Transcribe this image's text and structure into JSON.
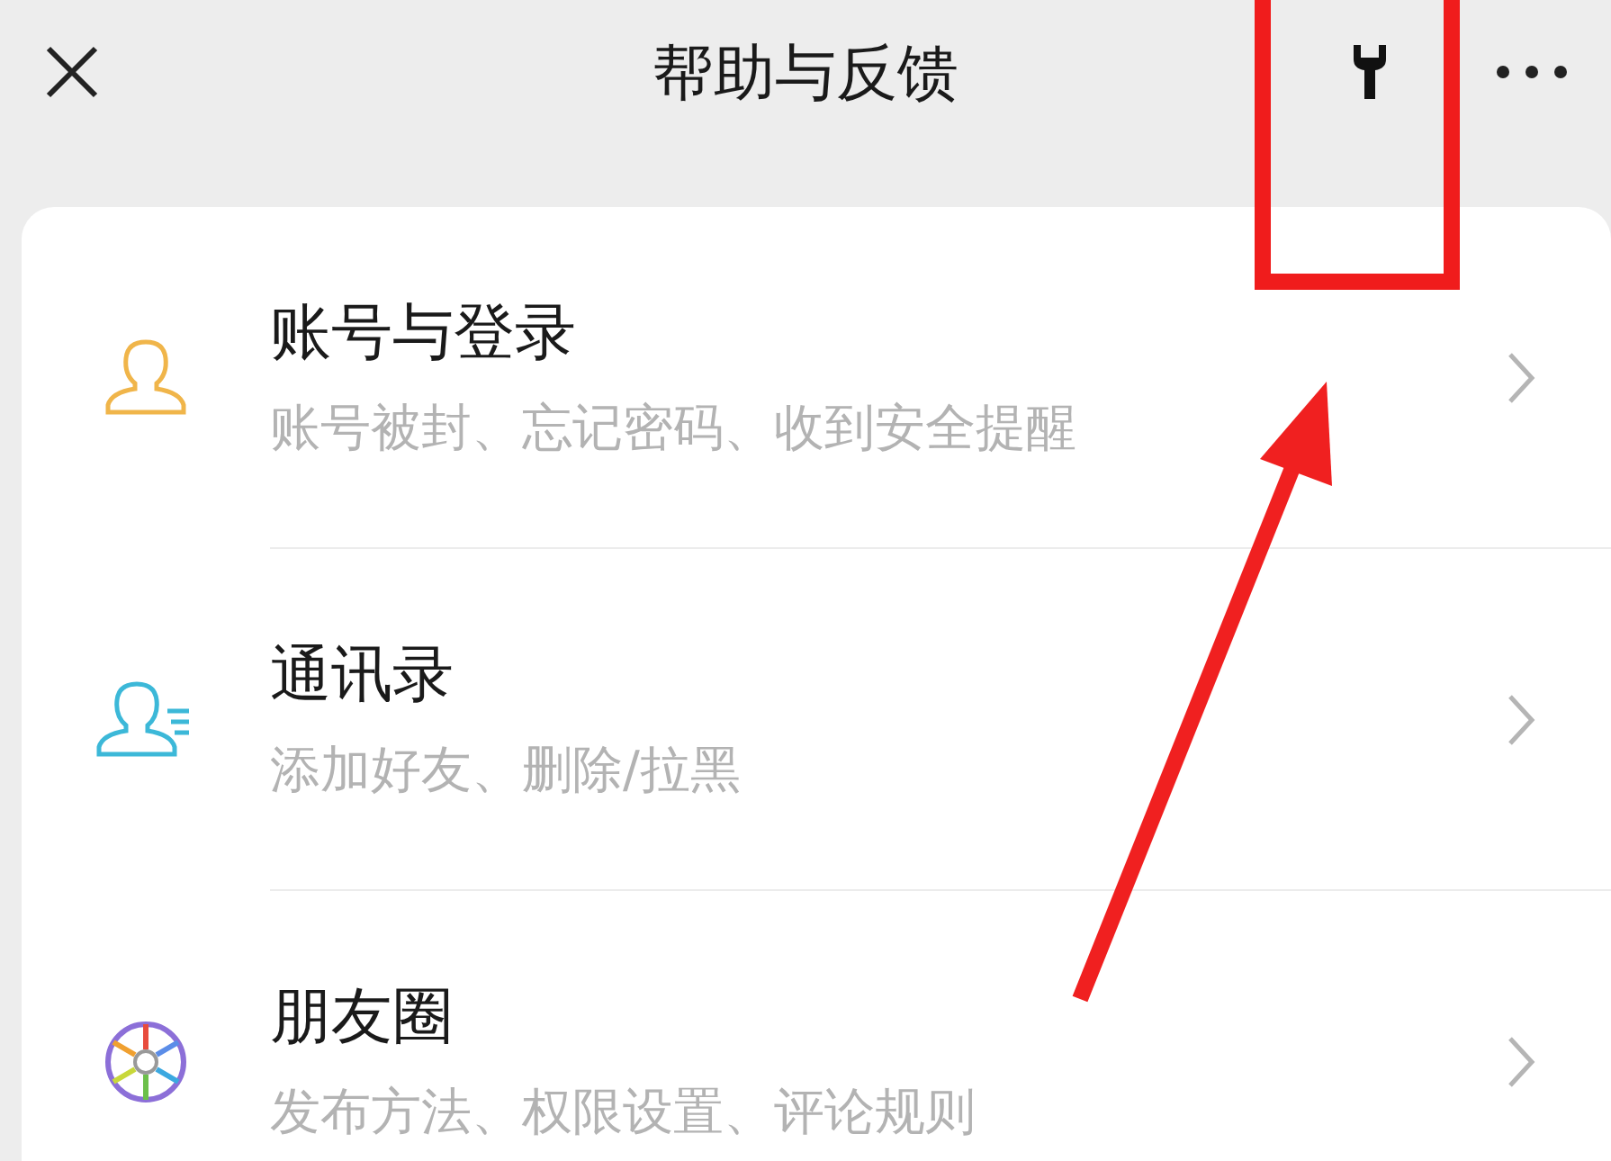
{
  "nav_bar": {
    "title": "帮助与反馈"
  },
  "topics": [
    {
      "kind": "account",
      "title": "账号与登录",
      "subtitle": "账号被封、忘记密码、收到安全提醒"
    },
    {
      "kind": "contacts",
      "title": "通讯录",
      "subtitle": "添加好友、删除/拉黑"
    },
    {
      "kind": "moments",
      "title": "朋友圈",
      "subtitle": "发布方法、权限设置、评论规则"
    }
  ]
}
